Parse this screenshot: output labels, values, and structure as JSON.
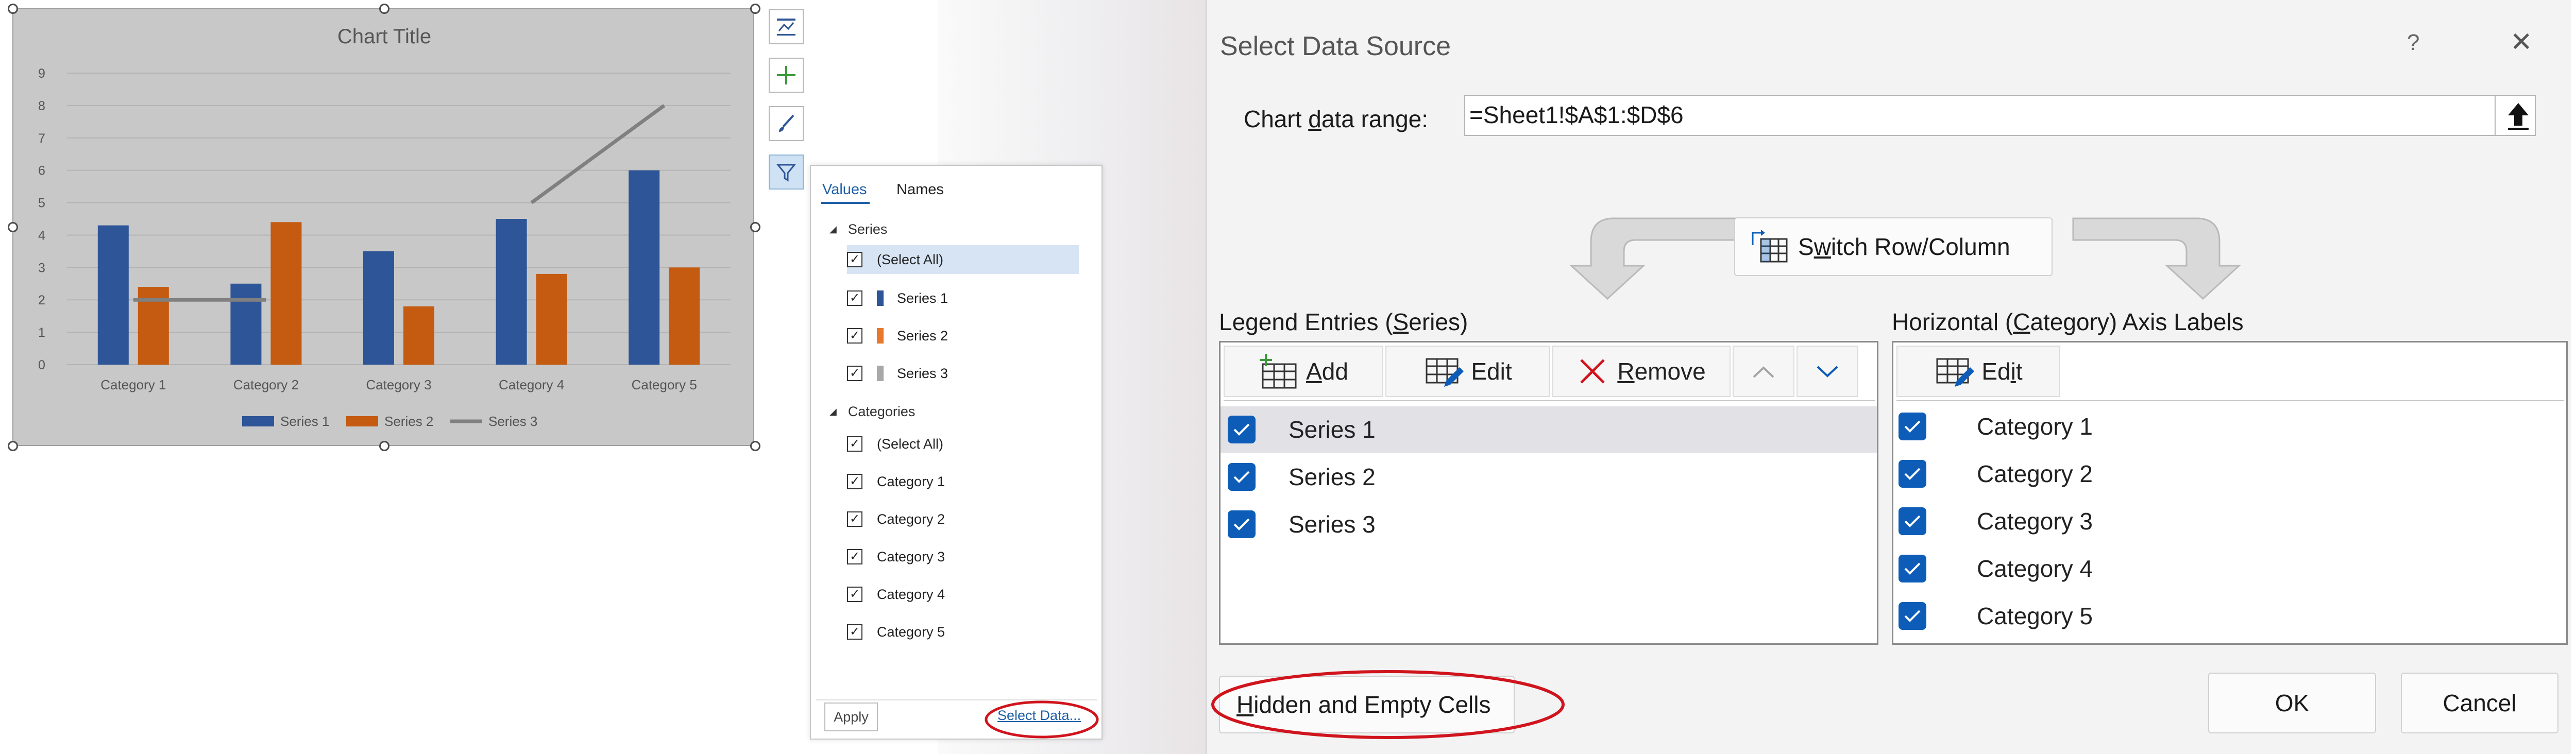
{
  "chart": {
    "title": "Chart Title",
    "side_buttons": [
      "chart-elements-icon",
      "plus-icon",
      "brush-icon",
      "filter-icon"
    ]
  },
  "chart_data": {
    "type": "bar",
    "title": "Chart Title",
    "categories": [
      "Category 1",
      "Category 2",
      "Category 3",
      "Category 4",
      "Category 5"
    ],
    "series": [
      {
        "name": "Series 1",
        "type": "bar",
        "values": [
          4.3,
          2.5,
          3.5,
          4.5,
          6.0
        ],
        "color": "#2e5597"
      },
      {
        "name": "Series 2",
        "type": "bar",
        "values": [
          2.4,
          4.4,
          1.8,
          2.8,
          3.0
        ],
        "color": "#c55a11"
      },
      {
        "name": "Series 3",
        "type": "line",
        "values": [
          2.0,
          2.0,
          null,
          5.0,
          8.0
        ],
        "color": "#808080"
      }
    ],
    "ylim": [
      0,
      9
    ],
    "yticks": [
      0,
      1,
      2,
      3,
      4,
      5,
      6,
      7,
      8,
      9
    ],
    "grid": true,
    "legend": "bottom"
  },
  "filter_panel": {
    "tabs": [
      "Values",
      "Names"
    ],
    "series_heading": "Series",
    "series_items": [
      {
        "label": "(Select All)",
        "checked": true,
        "color": ""
      },
      {
        "label": "Series 1",
        "checked": true,
        "color": "#2e5597"
      },
      {
        "label": "Series 2",
        "checked": true,
        "color": "#e8782b"
      },
      {
        "label": "Series 3",
        "checked": true,
        "color": "#a8a8a8"
      }
    ],
    "categories_heading": "Categories",
    "category_items": [
      {
        "label": "(Select All)",
        "checked": true
      },
      {
        "label": "Category 1",
        "checked": true
      },
      {
        "label": "Category 2",
        "checked": true
      },
      {
        "label": "Category 3",
        "checked": true
      },
      {
        "label": "Category 4",
        "checked": true
      },
      {
        "label": "Category 5",
        "checked": true
      }
    ],
    "apply": "Apply",
    "select_data": "Select Data..."
  },
  "dialog": {
    "title": "Select Data Source",
    "help": "?",
    "close": "✕",
    "range_label_pre": "Chart ",
    "range_label_u": "d",
    "range_label_post": "ata range:",
    "range_value": "=Sheet1!$A$1:$D$6",
    "switch_pre": "S",
    "switch_u": "w",
    "switch_post": "itch Row/Column",
    "legend_label_pre": "Legend Entries (",
    "legend_label_u": "S",
    "legend_label_post": "eries)",
    "axis_label_pre": "Horizontal (",
    "axis_label_u": "C",
    "axis_label_post": "ategory) Axis Labels",
    "add_u": "A",
    "add_post": "dd",
    "edit": "Edit",
    "remove_u": "R",
    "remove_post": "emove",
    "axis_edit_pre": "Ed",
    "axis_edit_u": "i",
    "axis_edit_post": "t",
    "legend_items": [
      "Series 1",
      "Series 2",
      "Series 3"
    ],
    "axis_items": [
      "Category 1",
      "Category 2",
      "Category 3",
      "Category 4",
      "Category 5"
    ],
    "hidden_u": "H",
    "hidden_post": "idden and Empty Cells",
    "ok": "OK",
    "cancel": "Cancel"
  },
  "colors": {
    "accent": "#0d5db8",
    "annotation": "#d0141d"
  }
}
